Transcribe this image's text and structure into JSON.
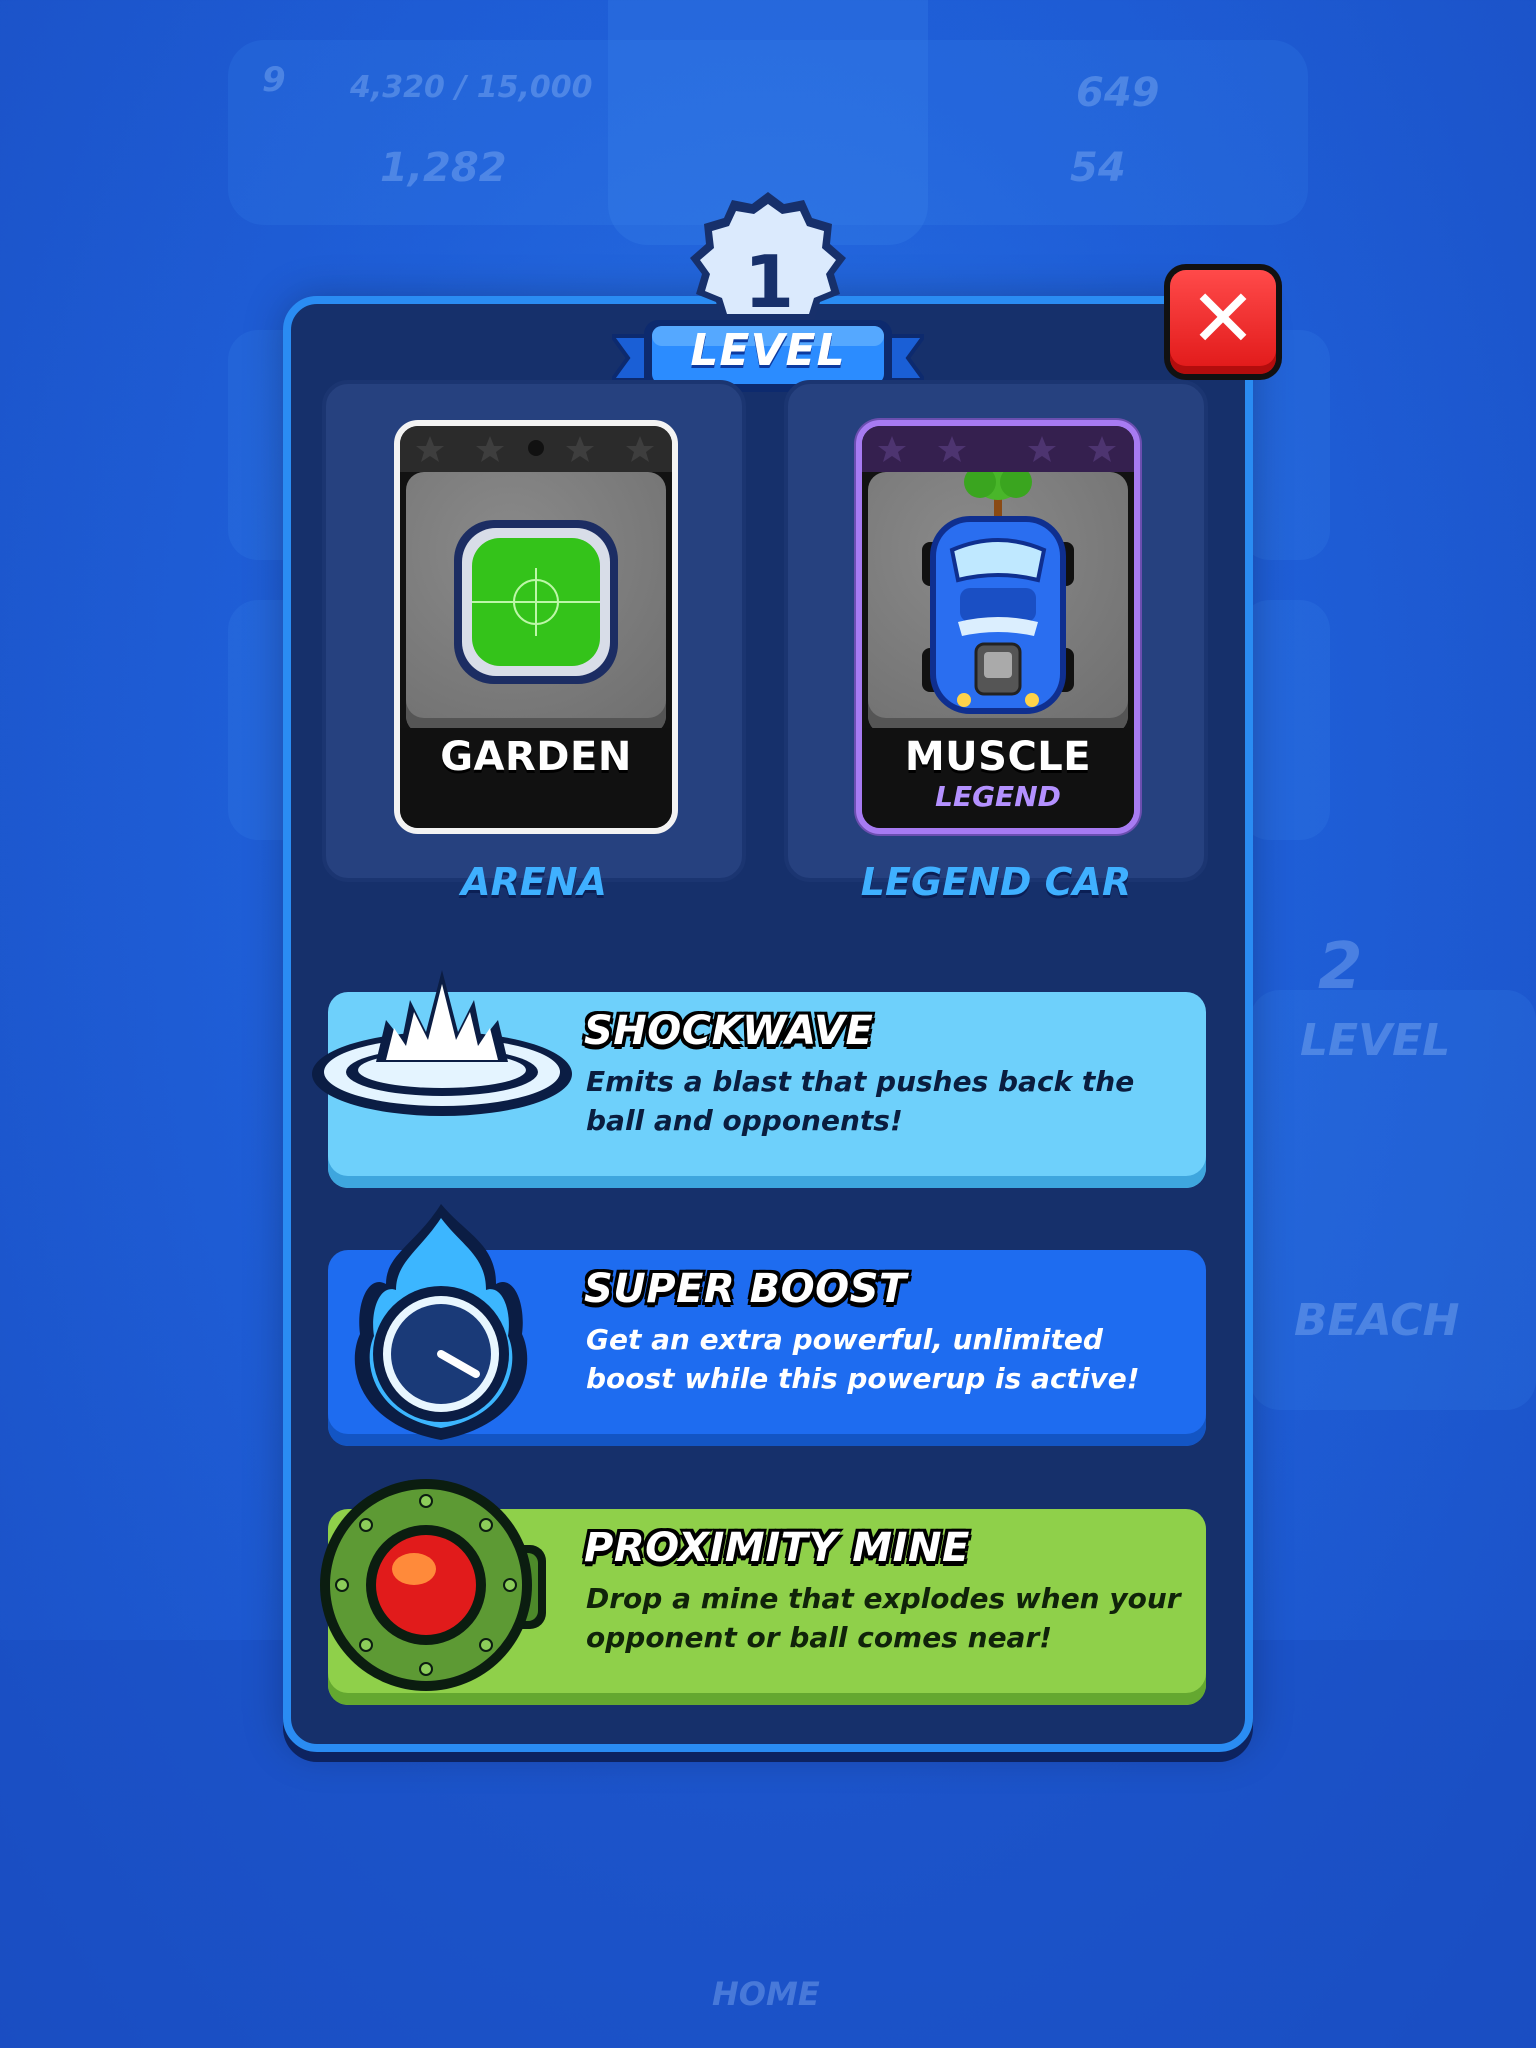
{
  "background": {
    "xp_text": "4,320 / 15,000",
    "level_num": "9",
    "coins": "1,282",
    "trophies": "649",
    "gems": "54",
    "next_level_num": "2",
    "next_level_label": "LEVEL",
    "next_arena": "BEACH",
    "home_label": "HOME"
  },
  "modal": {
    "level_number": "1",
    "level_label": "LEVEL",
    "rewards": [
      {
        "card_name": "GARDEN",
        "card_sub": "",
        "caption": "ARENA"
      },
      {
        "card_name": "MUSCLE",
        "card_sub": "LEGEND",
        "caption": "LEGEND CAR"
      }
    ],
    "powerups": [
      {
        "title": "SHOCKWAVE",
        "desc": "Emits a blast that pushes back the ball and opponents!",
        "icon": "shockwave-icon"
      },
      {
        "title": "SUPER BOOST",
        "desc": "Get an extra powerful, unlimited boost while this powerup is active!",
        "icon": "super-boost-icon"
      },
      {
        "title": "PROXIMITY MINE",
        "desc": "Drop a mine that explodes when your opponent or ball comes near!",
        "icon": "proximity-mine-icon"
      }
    ]
  },
  "colors": {
    "background": "#1f5fd8",
    "modal": "#16306b",
    "shockwave_panel": "#6ed0fb",
    "boost_panel": "#1e6cf0",
    "mine_panel": "#8fd04a",
    "close_button": "#e01818",
    "caption": "#3fb0ff"
  }
}
